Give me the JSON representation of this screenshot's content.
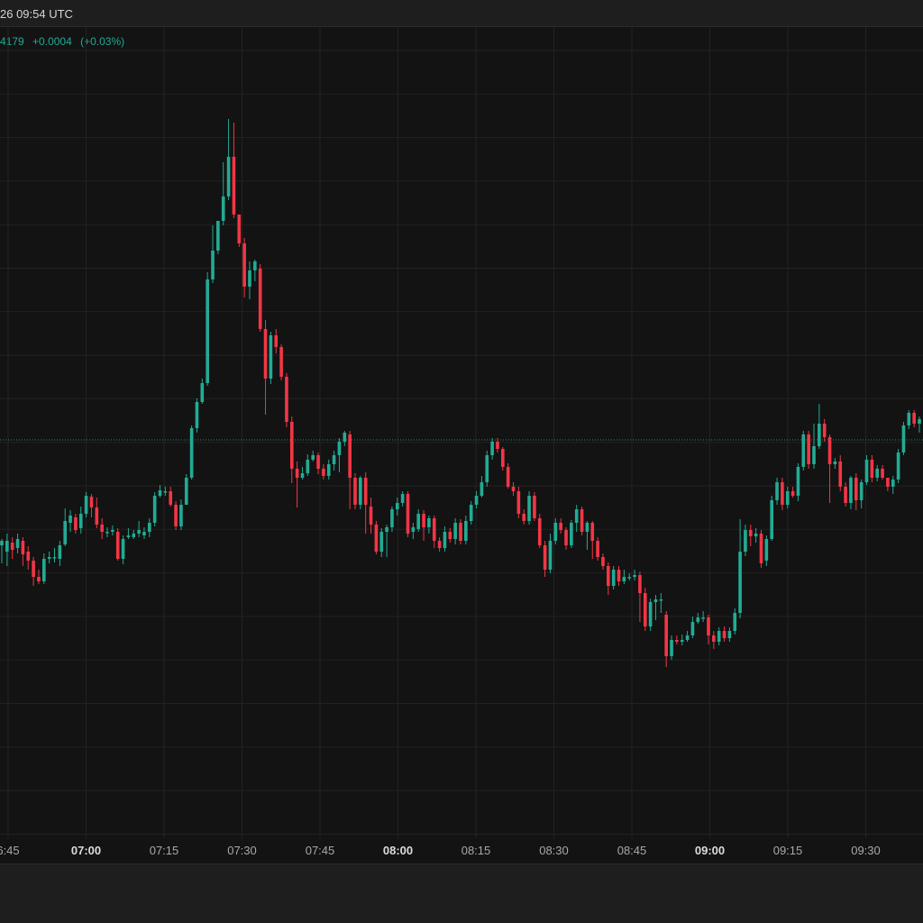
{
  "header": {
    "datetime": "26 09:54 UTC"
  },
  "quote": {
    "last": "4179",
    "change": "+0.0004",
    "change_pct": "(+0.03%)"
  },
  "colors": {
    "up": "#22ab94",
    "down": "#f23645",
    "grid": "#232323",
    "axis_text": "#a9a9a9",
    "axis_text_bold": "#dcdcdc",
    "price_line": "#22ab94"
  },
  "chart_data": {
    "type": "candlestick",
    "xlabel": "",
    "ylabel": "",
    "x_ticks": [
      {
        "label": "6:45",
        "bold": false
      },
      {
        "label": "07:00",
        "bold": true
      },
      {
        "label": "07:15",
        "bold": false
      },
      {
        "label": "07:30",
        "bold": false
      },
      {
        "label": "07:45",
        "bold": false
      },
      {
        "label": "08:00",
        "bold": true
      },
      {
        "label": "08:15",
        "bold": false
      },
      {
        "label": "08:30",
        "bold": false
      },
      {
        "label": "08:45",
        "bold": false
      },
      {
        "label": "09:00",
        "bold": true
      },
      {
        "label": "09:15",
        "bold": false
      },
      {
        "label": "09:30",
        "bold": false
      }
    ],
    "grid": true,
    "candles": [
      [
        605,
        600,
        598,
        625
      ],
      [
        612,
        600,
        592,
        628
      ],
      [
        602,
        610,
        596,
        620
      ],
      [
        608,
        598,
        592,
        614
      ],
      [
        600,
        615,
        596,
        628
      ],
      [
        612,
        622,
        606,
        632
      ],
      [
        622,
        640,
        618,
        650
      ],
      [
        640,
        645,
        632,
        648
      ],
      [
        645,
        620,
        614,
        648
      ],
      [
        620,
        618,
        612,
        625
      ],
      [
        618,
        618,
        608,
        624
      ],
      [
        620,
        605,
        600,
        628
      ],
      [
        604,
        578,
        564,
        606
      ],
      [
        580,
        572,
        566,
        590
      ],
      [
        574,
        588,
        570,
        592
      ],
      [
        586,
        570,
        562,
        592
      ],
      [
        570,
        550,
        546,
        574
      ],
      [
        551,
        563,
        548,
        574
      ],
      [
        563,
        582,
        552,
        586
      ],
      [
        582,
        590,
        575,
        598
      ],
      [
        590,
        590,
        585,
        596
      ],
      [
        590,
        588,
        583,
        594
      ],
      [
        590,
        620,
        586,
        622
      ],
      [
        620,
        598,
        594,
        626
      ],
      [
        596,
        594,
        586,
        598
      ],
      [
        596,
        592,
        588,
        598
      ],
      [
        592,
        588,
        578,
        596
      ],
      [
        594,
        590,
        585,
        598
      ],
      [
        590,
        580,
        575,
        596
      ],
      [
        580,
        550,
        546,
        584
      ],
      [
        550,
        544,
        538,
        552
      ],
      [
        546,
        545,
        540,
        550
      ],
      [
        545,
        560,
        540,
        562
      ],
      [
        560,
        584,
        556,
        588
      ],
      [
        584,
        560,
        554,
        588
      ],
      [
        560,
        530,
        526,
        556
      ],
      [
        530,
        475,
        472,
        532
      ],
      [
        475,
        446,
        442,
        480
      ],
      [
        446,
        425,
        420,
        448
      ],
      [
        425,
        310,
        302,
        428
      ],
      [
        310,
        278,
        250,
        314
      ],
      [
        278,
        245,
        248,
        282
      ],
      [
        245,
        218,
        180,
        250
      ],
      [
        218,
        174,
        132,
        222
      ],
      [
        174,
        238,
        136,
        242
      ],
      [
        238,
        270,
        240,
        274
      ],
      [
        270,
        318,
        264,
        330
      ],
      [
        318,
        300,
        290,
        332
      ],
      [
        300,
        290,
        288,
        312
      ],
      [
        298,
        365,
        293,
        368
      ],
      [
        365,
        420,
        355,
        460
      ],
      [
        420,
        372,
        368,
        426
      ],
      [
        372,
        385,
        365,
        392
      ],
      [
        385,
        418,
        382,
        422
      ],
      [
        418,
        468,
        414,
        474
      ],
      [
        468,
        520,
        462,
        536
      ],
      [
        520,
        530,
        512,
        563
      ],
      [
        530,
        525,
        518,
        532
      ],
      [
        525,
        510,
        504,
        528
      ],
      [
        510,
        505,
        500,
        512
      ],
      [
        505,
        520,
        502,
        526
      ],
      [
        520,
        528,
        515,
        532
      ],
      [
        528,
        515,
        510,
        532
      ],
      [
        515,
        505,
        500,
        522
      ],
      [
        505,
        490,
        486,
        524
      ],
      [
        490,
        480,
        478,
        495
      ],
      [
        482,
        530,
        478,
        565
      ],
      [
        530,
        560,
        525,
        565
      ],
      [
        560,
        530,
        528,
        565
      ],
      [
        530,
        560,
        524,
        592
      ],
      [
        562,
        582,
        552,
        592
      ],
      [
        582,
        612,
        578,
        615
      ],
      [
        612,
        590,
        586,
        618
      ],
      [
        590,
        585,
        582,
        618
      ],
      [
        585,
        565,
        562,
        590
      ],
      [
        565,
        558,
        552,
        572
      ],
      [
        558,
        548,
        545,
        562
      ],
      [
        548,
        592,
        545,
        596
      ],
      [
        590,
        585,
        580,
        598
      ],
      [
        587,
        570,
        565,
        590
      ],
      [
        570,
        585,
        566,
        600
      ],
      [
        585,
        575,
        572,
        592
      ],
      [
        575,
        600,
        572,
        608
      ],
      [
        600,
        608,
        596,
        612
      ],
      [
        608,
        590,
        584,
        612
      ],
      [
        590,
        598,
        586,
        602
      ],
      [
        598,
        580,
        575,
        604
      ],
      [
        580,
        600,
        576,
        604
      ],
      [
        600,
        578,
        572,
        604
      ],
      [
        578,
        560,
        556,
        582
      ],
      [
        560,
        550,
        545,
        564
      ],
      [
        550,
        535,
        528,
        552
      ],
      [
        535,
        505,
        500,
        540
      ],
      [
        505,
        490,
        486,
        510
      ],
      [
        490,
        498,
        486,
        502
      ],
      [
        498,
        518,
        496,
        522
      ],
      [
        518,
        540,
        514,
        542
      ],
      [
        540,
        545,
        535,
        550
      ],
      [
        545,
        570,
        540,
        575
      ],
      [
        570,
        578,
        565,
        582
      ],
      [
        578,
        550,
        545,
        582
      ],
      [
        550,
        575,
        546,
        578
      ],
      [
        575,
        605,
        570,
        608
      ],
      [
        605,
        632,
        600,
        640
      ],
      [
        632,
        600,
        592,
        636
      ],
      [
        600,
        580,
        575,
        604
      ],
      [
        580,
        588,
        575,
        592
      ],
      [
        588,
        605,
        585,
        610
      ],
      [
        605,
        580,
        577,
        608
      ],
      [
        580,
        565,
        560,
        590
      ],
      [
        565,
        590,
        562,
        594
      ],
      [
        590,
        580,
        578,
        610
      ],
      [
        580,
        600,
        578,
        620
      ],
      [
        600,
        618,
        596,
        622
      ],
      [
        618,
        628,
        614,
        632
      ],
      [
        628,
        650,
        624,
        660
      ],
      [
        650,
        632,
        628,
        654
      ],
      [
        632,
        645,
        628,
        650
      ],
      [
        645,
        640,
        632,
        648
      ],
      [
        640,
        640,
        636,
        644
      ],
      [
        640,
        638,
        632,
        644
      ],
      [
        638,
        658,
        634,
        690
      ],
      [
        658,
        695,
        652,
        700
      ],
      [
        695,
        668,
        664,
        700
      ],
      [
        668,
        665,
        660,
        688
      ],
      [
        665,
        665,
        658,
        680
      ],
      [
        682,
        728,
        678,
        740
      ],
      [
        728,
        710,
        705,
        732
      ],
      [
        710,
        712,
        705,
        715
      ],
      [
        712,
        710,
        704,
        716
      ],
      [
        710,
        705,
        700,
        712
      ],
      [
        705,
        690,
        684,
        708
      ],
      [
        690,
        685,
        680,
        692
      ],
      [
        685,
        685,
        678,
        690
      ],
      [
        685,
        705,
        682,
        715
      ],
      [
        705,
        712,
        700,
        720
      ],
      [
        712,
        700,
        696,
        716
      ],
      [
        700,
        708,
        695,
        712
      ],
      [
        708,
        700,
        696,
        712
      ],
      [
        700,
        680,
        675,
        704
      ],
      [
        680,
        612,
        576,
        686
      ],
      [
        612,
        588,
        582,
        617
      ],
      [
        588,
        595,
        582,
        606
      ],
      [
        595,
        592,
        586,
        602
      ],
      [
        592,
        625,
        588,
        630
      ],
      [
        622,
        598,
        594,
        628
      ],
      [
        598,
        555,
        550,
        600
      ],
      [
        555,
        535,
        530,
        560
      ],
      [
        535,
        560,
        530,
        566
      ],
      [
        560,
        545,
        540,
        564
      ],
      [
        545,
        550,
        540,
        552
      ],
      [
        550,
        518,
        514,
        556
      ],
      [
        518,
        482,
        478,
        522
      ],
      [
        482,
        515,
        478,
        520
      ],
      [
        515,
        495,
        470,
        520
      ],
      [
        495,
        470,
        448,
        498
      ],
      [
        470,
        485,
        465,
        490
      ],
      [
        485,
        515,
        482,
        558
      ],
      [
        515,
        512,
        508,
        520
      ],
      [
        512,
        540,
        505,
        545
      ],
      [
        540,
        558,
        535,
        562
      ],
      [
        558,
        530,
        528,
        565
      ],
      [
        530,
        555,
        525,
        566
      ],
      [
        555,
        535,
        532,
        564
      ],
      [
        535,
        510,
        505,
        538
      ],
      [
        510,
        530,
        505,
        535
      ],
      [
        530,
        520,
        516,
        534
      ],
      [
        520,
        530,
        516,
        532
      ],
      [
        530,
        540,
        530,
        545
      ],
      [
        540,
        532,
        528,
        548
      ],
      [
        532,
        502,
        498,
        536
      ],
      [
        502,
        472,
        468,
        505
      ],
      [
        472,
        458,
        455,
        476
      ],
      [
        458,
        470,
        455,
        474
      ],
      [
        470,
        465,
        462,
        480
      ]
    ],
    "y_range": [
      1024,
      0
    ],
    "last_price_level": 488
  }
}
